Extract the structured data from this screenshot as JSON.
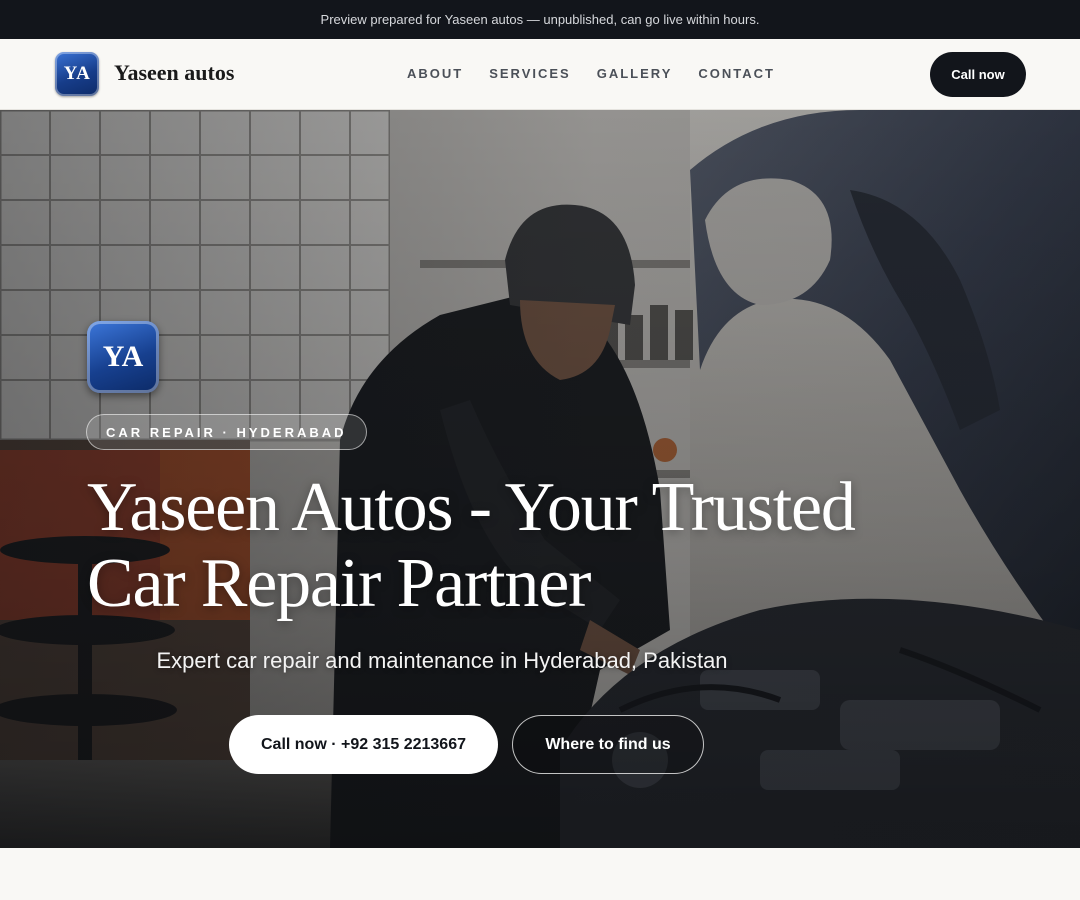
{
  "preview_banner": {
    "text": "Preview prepared for Yaseen autos — unpublished, can go live within hours."
  },
  "navbar": {
    "logo_text": "YA",
    "brand_name": "Yaseen autos",
    "links": [
      {
        "label": "ABOUT"
      },
      {
        "label": "SERVICES"
      },
      {
        "label": "GALLERY"
      },
      {
        "label": "CONTACT"
      }
    ],
    "cta_label": "Call now"
  },
  "hero": {
    "logo_text": "YA",
    "tag": "CAR REPAIR · HYDERABAD",
    "title": "Yaseen Autos - Your Trusted Car Repair Partner",
    "subtitle": "Expert car repair and maintenance in Hyderabad, Pakistan",
    "primary_button": "Call now · +92 315 2213667",
    "secondary_button": "Where to find us",
    "background_image": "mechanic-working-under-car-hood-photo"
  },
  "colors": {
    "dark": "#12151b",
    "page_bg": "#f9f8f5",
    "logo_blue": "#173d8a"
  }
}
